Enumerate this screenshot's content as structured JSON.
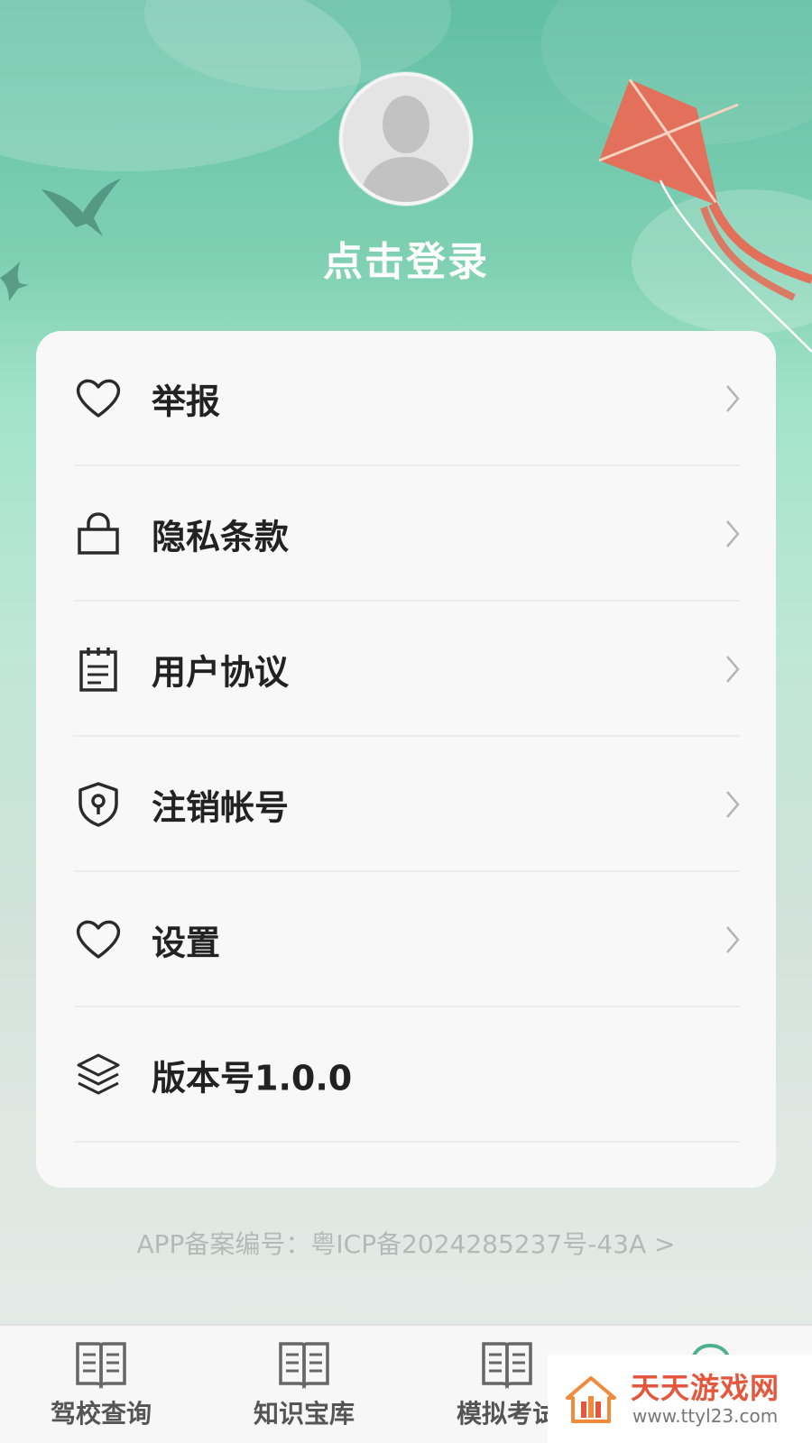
{
  "profile": {
    "login_label": "点击登录"
  },
  "menu": [
    {
      "label": "举报",
      "icon": "heart-icon",
      "has_arrow": true
    },
    {
      "label": "隐私条款",
      "icon": "lock-icon",
      "has_arrow": true
    },
    {
      "label": "用户协议",
      "icon": "clipboard-icon",
      "has_arrow": true
    },
    {
      "label": "注销帐号",
      "icon": "shield-keyhole-icon",
      "has_arrow": true
    },
    {
      "label": "设置",
      "icon": "heart-icon",
      "has_arrow": true
    },
    {
      "label": "版本号1.0.0",
      "icon": "layers-icon",
      "has_arrow": false
    }
  ],
  "footer": {
    "icp": "APP备案编号：粤ICP备2024285237号-43A >"
  },
  "tabbar": [
    {
      "label": "驾校查询",
      "icon": "book-icon"
    },
    {
      "label": "知识宝库",
      "icon": "book-icon"
    },
    {
      "label": "模拟考试",
      "icon": "book-icon"
    },
    {
      "label": "",
      "icon": "profile-icon"
    }
  ],
  "watermark": {
    "title": "天天游戏网",
    "url": "www.ttyl23.com"
  },
  "colors": {
    "header_top": "#62bfa3",
    "kite": "#e2705a",
    "watermark_red": "#e5573d"
  }
}
